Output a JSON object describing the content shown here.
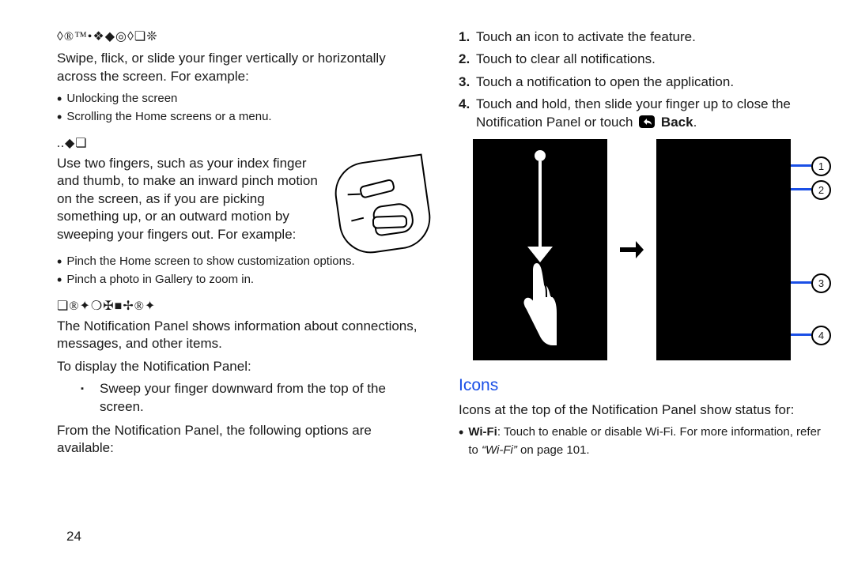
{
  "page_number": "24",
  "left": {
    "heading1_glyphs": "◊®™•❖◆◎◊❏❊",
    "swipe_para": "Swipe, flick, or slide your finger vertically or horizontally across the screen. For example:",
    "swipe_bullets": [
      "Unlocking the screen",
      "Scrolling the Home screens or a menu."
    ],
    "heading2_glyphs": "..◆❏",
    "pinch_para": "Use two fingers, such as your index finger and thumb, to make an inward pinch motion on the screen, as if you are picking something up, or an outward motion by sweeping your fingers out. For example:",
    "pinch_bullets": [
      "Pinch the Home screen to show customization options.",
      "Pinch a photo in Gallery to zoom in."
    ],
    "heading3_glyphs": "❏®✦❍✠■✢®✦",
    "notif_para": "The Notification Panel shows information about connections, messages, and other items.",
    "notif_lead": "To display the Notification Panel:",
    "notif_step": "Sweep your finger downward from the top of the screen.",
    "notif_tail": "From the Notification Panel, the following options are available:"
  },
  "right": {
    "steps": [
      "Touch an icon to activate the feature.",
      "Touch to clear all notifications.",
      "Touch a notification to open the application.",
      "Touch and hold, then slide your finger up to close the Notification Panel or touch"
    ],
    "back_label": "Back",
    "callouts": [
      "1",
      "2",
      "3",
      "4"
    ],
    "icons_head": "Icons",
    "icons_para": "Icons at the top of the Notification Panel show status for:",
    "wifi_item_prefix": "Wi-Fi",
    "wifi_item_body": ": Touch to enable or disable Wi-Fi. For more information, refer to ",
    "wifi_ref": "“Wi-Fi”",
    "wifi_tail": " on page 101."
  }
}
